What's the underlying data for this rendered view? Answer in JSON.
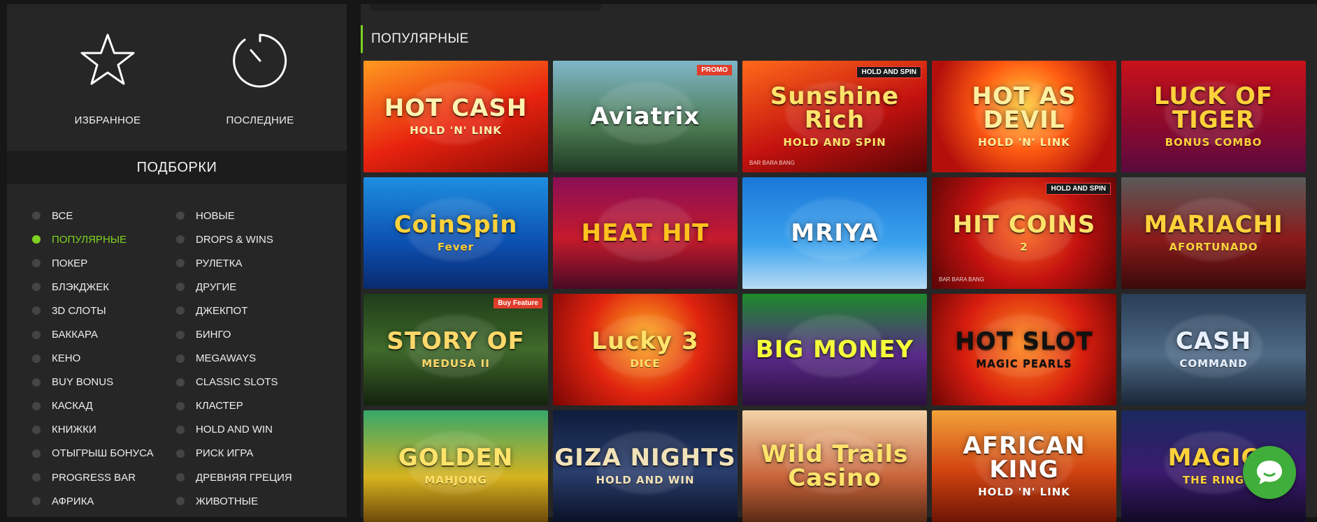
{
  "quick_links": [
    {
      "label": "ИЗБРАННОЕ",
      "icon": "star-icon"
    },
    {
      "label": "ПОСЛЕДНИЕ",
      "icon": "timer-icon"
    }
  ],
  "selections_title": "ПОДБОРКИ",
  "categories_col1": [
    {
      "label": "ВСЕ",
      "active": false
    },
    {
      "label": "ПОПУЛЯРНЫЕ",
      "active": true
    },
    {
      "label": "ПОКЕР",
      "active": false
    },
    {
      "label": "БЛЭКДЖЕК",
      "active": false
    },
    {
      "label": "3D СЛОТЫ",
      "active": false
    },
    {
      "label": "БАККАРА",
      "active": false
    },
    {
      "label": "КЕНО",
      "active": false
    },
    {
      "label": "BUY BONUS",
      "active": false
    },
    {
      "label": "КАСКАД",
      "active": false
    },
    {
      "label": "КНИЖКИ",
      "active": false
    },
    {
      "label": "ОТЫГРЫШ БОНУСА",
      "active": false
    },
    {
      "label": "PROGRESS BAR",
      "active": false
    },
    {
      "label": "АФРИКА",
      "active": false
    }
  ],
  "categories_col2": [
    {
      "label": "НОВЫЕ",
      "active": false
    },
    {
      "label": "DROPS & WINS",
      "active": false
    },
    {
      "label": "РУЛЕТКА",
      "active": false
    },
    {
      "label": "ДРУГИЕ",
      "active": false
    },
    {
      "label": "ДЖЕКПОТ",
      "active": false
    },
    {
      "label": "БИНГО",
      "active": false
    },
    {
      "label": "MEGAWAYS",
      "active": false
    },
    {
      "label": "CLASSIC SLOTS",
      "active": false
    },
    {
      "label": "КЛАСТЕР",
      "active": false
    },
    {
      "label": "HOLD AND WIN",
      "active": false
    },
    {
      "label": "РИСК ИГРА",
      "active": false
    },
    {
      "label": "ДРЕВНЯЯ ГРЕЦИЯ",
      "active": false
    },
    {
      "label": "ЖИВОТНЫЕ",
      "active": false
    }
  ],
  "section_title": "ПОПУЛЯРНЫЕ",
  "games": [
    {
      "title": "HOT CASH",
      "subtitle": "HOLD 'N' LINK",
      "bg": "linear-gradient(160deg,#ff9a1f 0%,#e8230f 55%,#8b0a05 100%)",
      "color": "#fff3b0"
    },
    {
      "title": "Aviatrix",
      "subtitle": "",
      "badge": "PROMO",
      "bg": "linear-gradient(180deg,#7fb6c9 0%,#4b7a52 60%,#1f3a22 100%)",
      "color": "#ffffff"
    },
    {
      "title": "Sunshine Rich",
      "subtitle": "HOLD AND SPIN",
      "badge": "HOLD AND SPIN",
      "corner": "BAR BARA BANG",
      "bg": "linear-gradient(160deg,#ff6a1a 0%,#c3120f 55%,#5a0505 100%)",
      "color": "#ffe36b"
    },
    {
      "title": "HOT AS DEVIL",
      "subtitle": "HOLD 'N' LINK",
      "bg": "radial-gradient(circle at 50% 40%,#ffcf3a 0%,#ff5b12 40%,#b3100c 80%)",
      "color": "#fff0a0"
    },
    {
      "title": "LUCK OF TIGER",
      "subtitle": "BONUS COMBO",
      "bg": "linear-gradient(180deg,#c9121a 0%,#8e0a2c 55%,#5a0a3e 100%)",
      "color": "#ffd23a"
    },
    {
      "title": "CoinSpin",
      "subtitle": "Fever",
      "bg": "linear-gradient(180deg,#1e8fe0 0%,#0c4fb0 60%,#0a2a6e 100%)",
      "color": "#ffd23a"
    },
    {
      "title": "HEAT HIT",
      "subtitle": "",
      "bg": "linear-gradient(180deg,#8a0f55 0%,#c51a2c 55%,#4a0a25 100%)",
      "color": "#ffc21f"
    },
    {
      "title": "MRIYA",
      "subtitle": "",
      "bg": "linear-gradient(180deg,#1a78d8 0%,#3ba3ee 60%,#b9dcf5 100%)",
      "color": "#ffffff"
    },
    {
      "title": "HIT COINS",
      "subtitle": "2",
      "badge": "HOLD AND SPIN",
      "corner": "BAR BARA BANG",
      "bg": "radial-gradient(circle at 50% 45%,#ff6a1a 0%,#c3120f 50%,#5a0505 100%)",
      "color": "#ffe36b"
    },
    {
      "title": "MARIACHI",
      "subtitle": "AFORTUNADO",
      "bg": "linear-gradient(180deg,#5a5a5a 0%,#8a1a1a 55%,#3a0a0a 100%)",
      "color": "#ffd23a"
    },
    {
      "title": "STORY OF",
      "subtitle": "MEDUSA II",
      "badge": "Buy Feature",
      "bg": "linear-gradient(180deg,#1f3d1a 0%,#3f6a2a 50%,#14220e 100%)",
      "color": "#ffd86a"
    },
    {
      "title": "Lucky 3",
      "subtitle": "DICE",
      "bg": "radial-gradient(circle at 50% 40%,#ffb21f 0%,#e0240f 50%,#7a0505 100%)",
      "color": "#ffe36b"
    },
    {
      "title": "BIG MONEY",
      "subtitle": "",
      "bg": "linear-gradient(180deg,#1c8a2a 0%,#5a2a8a 55%,#2a103e 100%)",
      "color": "#f5ff3a"
    },
    {
      "title": "HOT SLOT",
      "subtitle": "MAGIC PEARLS",
      "bg": "radial-gradient(circle at 50% 45%,#ff8a1a 0%,#d81d0f 55%,#6e0505 100%)",
      "color": "#111111"
    },
    {
      "title": "CASH",
      "subtitle": "COMMAND",
      "bg": "linear-gradient(180deg,#2a3e56 0%,#4e6a86 55%,#1a2636 100%)",
      "color": "#e9f1ff"
    },
    {
      "title": "GOLDEN",
      "subtitle": "MAHJONG",
      "bg": "linear-gradient(180deg,#36a86a 0%,#d6b21f 60%,#6e4a0a 100%)",
      "color": "#ffe36b"
    },
    {
      "title": "GIZA NIGHTS",
      "subtitle": "HOLD AND WIN",
      "bg": "linear-gradient(180deg,#0e1c3a 0%,#2a3e6e 55%,#0a1226 100%)",
      "color": "#f2e2b8"
    },
    {
      "title": "Wild Trails Casino",
      "subtitle": "",
      "bg": "linear-gradient(180deg,#f2d3a8 0%,#c8643a 60%,#5a2a14 100%)",
      "color": "#ffe36b"
    },
    {
      "title": "AFRICAN KING",
      "subtitle": "HOLD 'N' LINK",
      "bg": "linear-gradient(180deg,#f2a23a 0%,#d0420f 55%,#6e1505 100%)",
      "color": "#ffffff"
    },
    {
      "title": "MAGIC",
      "subtitle": "THE RING",
      "bg": "linear-gradient(180deg,#1a2a5e 0%,#3a1a6e 55%,#120a26 100%)",
      "color": "#ffd23a"
    }
  ],
  "colors": {
    "accent": "#7ed321",
    "chat": "#3fae3a"
  },
  "chat_icon": "chat-bubble-icon"
}
